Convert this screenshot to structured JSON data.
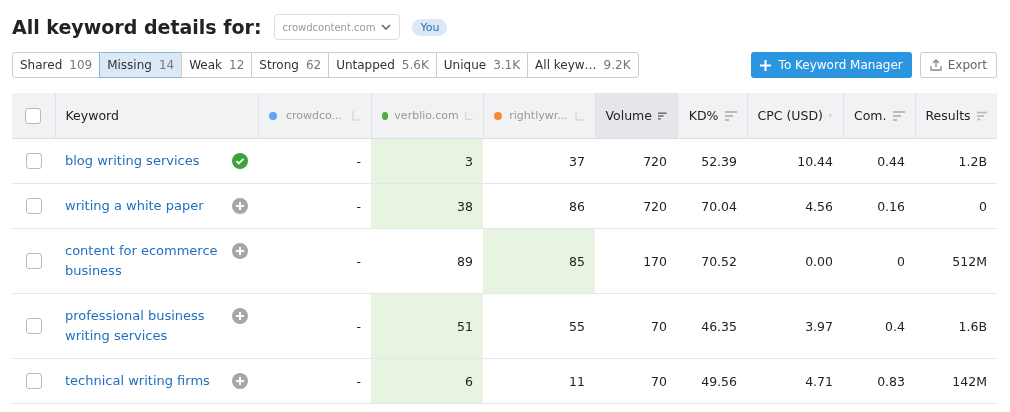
{
  "title": "All keyword details for:",
  "domain_select": {
    "value": "crowdcontent.com"
  },
  "you_badge": "You",
  "filters": [
    {
      "label": "Shared",
      "count": "109",
      "selected": false
    },
    {
      "label": "Missing",
      "count": "14",
      "selected": true
    },
    {
      "label": "Weak",
      "count": "12",
      "selected": false
    },
    {
      "label": "Strong",
      "count": "62",
      "selected": false
    },
    {
      "label": "Untapped",
      "count": "5.6K",
      "selected": false
    },
    {
      "label": "Unique",
      "count": "3.1K",
      "selected": false
    },
    {
      "label": "All keyw…",
      "count": "9.2K",
      "selected": false
    }
  ],
  "actions": {
    "primary": "To Keyword Manager",
    "export": "Export"
  },
  "table": {
    "select_all_checked": false,
    "columns": [
      {
        "label": "Keyword",
        "kind": "keyword",
        "sorted": false
      },
      {
        "label": "crowdco...",
        "kind": "domain",
        "color": "#59a6f5",
        "sorted": false
      },
      {
        "label": "verblio.com",
        "kind": "domain",
        "color": "#4caf3c",
        "sorted": false
      },
      {
        "label": "rightlywr...",
        "kind": "domain",
        "color": "#f5883a",
        "sorted": false
      },
      {
        "label": "Volume",
        "kind": "metric",
        "sorted": true
      },
      {
        "label": "KD%",
        "kind": "metric",
        "sorted": false
      },
      {
        "label": "CPC (USD)",
        "kind": "metric",
        "sorted": false
      },
      {
        "label": "Com.",
        "kind": "metric",
        "sorted": false
      },
      {
        "label": "Results",
        "kind": "metric",
        "sorted": false
      }
    ],
    "rows": [
      {
        "checked": false,
        "keyword": "blog writing services",
        "added": true,
        "ranks": [
          {
            "value": "-",
            "best": false
          },
          {
            "value": "3",
            "best": true
          },
          {
            "value": "37",
            "best": false
          }
        ],
        "metrics": [
          "720",
          "52.39",
          "10.44",
          "0.44",
          "1.2B"
        ]
      },
      {
        "checked": false,
        "keyword": "writing a white paper",
        "added": false,
        "ranks": [
          {
            "value": "-",
            "best": false
          },
          {
            "value": "38",
            "best": true
          },
          {
            "value": "86",
            "best": false
          }
        ],
        "metrics": [
          "720",
          "70.04",
          "4.56",
          "0.16",
          "0"
        ]
      },
      {
        "checked": false,
        "keyword": "content for ecommerce business",
        "added": false,
        "ranks": [
          {
            "value": "-",
            "best": false
          },
          {
            "value": "89",
            "best": false
          },
          {
            "value": "85",
            "best": true
          }
        ],
        "metrics": [
          "170",
          "70.52",
          "0.00",
          "0",
          "512M"
        ]
      },
      {
        "checked": false,
        "keyword": "professional business writing services",
        "added": false,
        "ranks": [
          {
            "value": "-",
            "best": false
          },
          {
            "value": "51",
            "best": true
          },
          {
            "value": "55",
            "best": false
          }
        ],
        "metrics": [
          "70",
          "46.35",
          "3.97",
          "0.4",
          "1.6B"
        ]
      },
      {
        "checked": false,
        "keyword": "technical writing firms",
        "added": false,
        "ranks": [
          {
            "value": "-",
            "best": false
          },
          {
            "value": "6",
            "best": true
          },
          {
            "value": "11",
            "best": false
          }
        ],
        "metrics": [
          "70",
          "49.56",
          "4.71",
          "0.83",
          "142M"
        ]
      }
    ]
  }
}
